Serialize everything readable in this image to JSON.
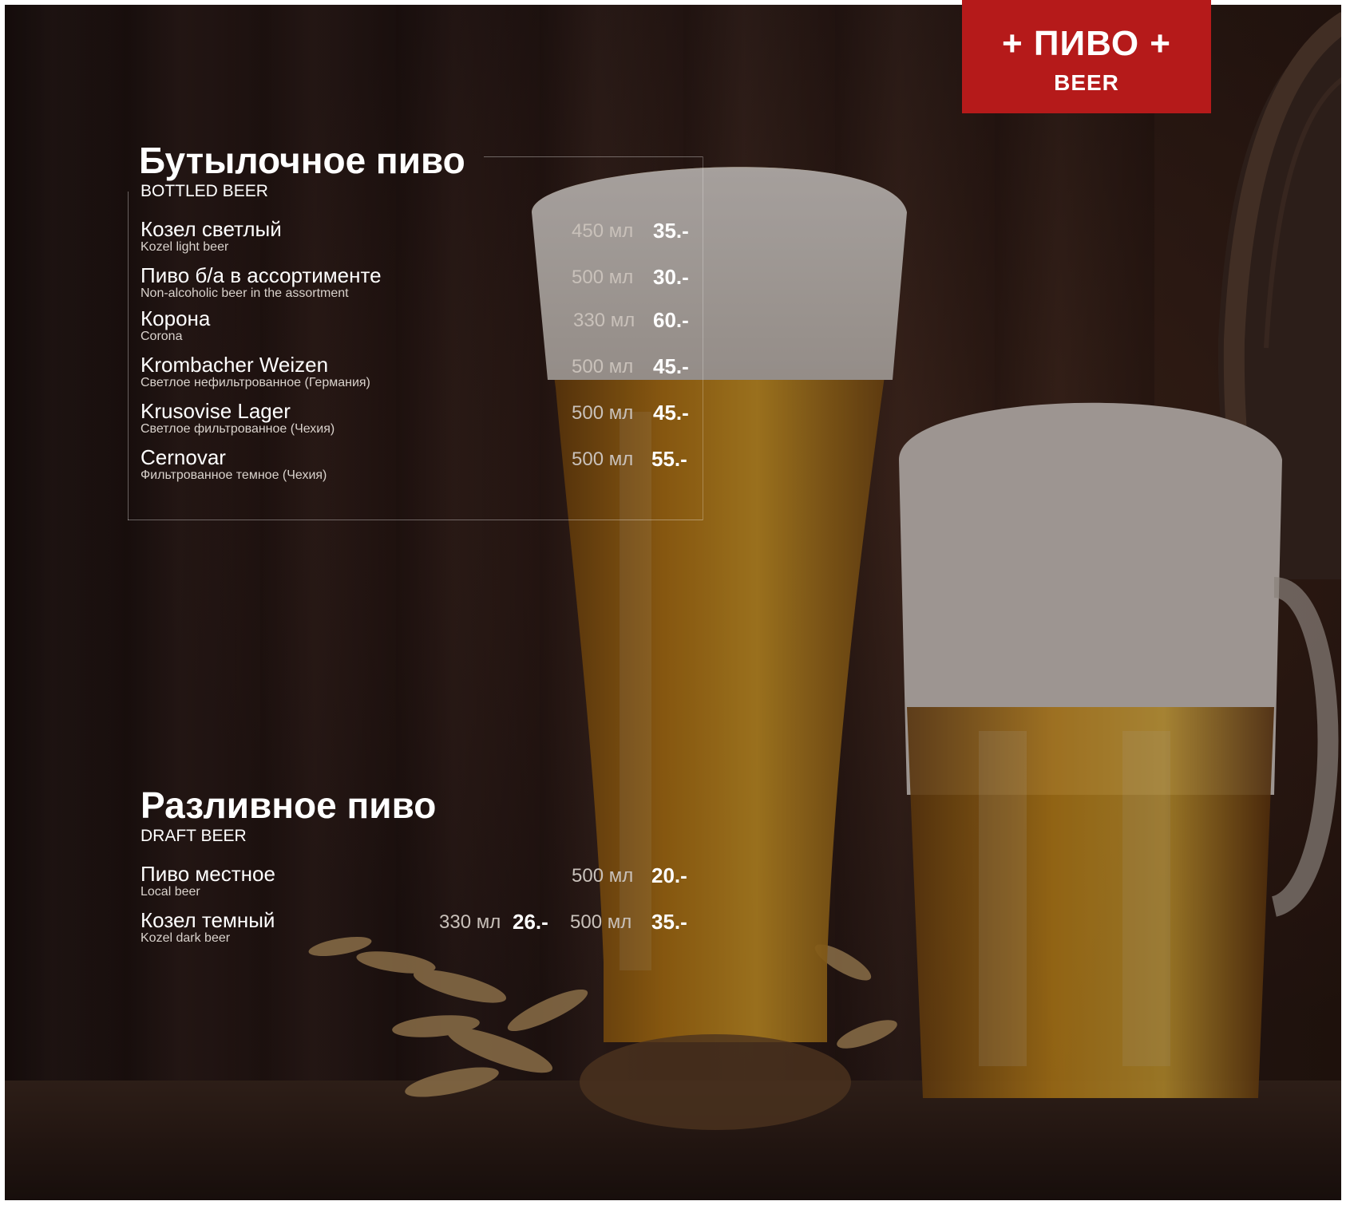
{
  "header": {
    "title": "+ ПИВО +",
    "subtitle": "BEER",
    "accent_color": "#b51a1a"
  },
  "bottled": {
    "title": "Бутылочное пиво",
    "subtitle": "BOTTLED BEER",
    "items": [
      {
        "name": "Козел светлый",
        "desc": "Kozel light beer",
        "volume": "450 мл",
        "price": "35.-"
      },
      {
        "name": "Пиво б/а в ассортименте",
        "desc": "Non-alcoholic beer in the assortment",
        "volume": "500 мл",
        "price": "30.-"
      },
      {
        "name": "Корона",
        "desc": "Corona",
        "volume": "330 мл",
        "price": "60.-"
      },
      {
        "name": "Krombacher Weizen",
        "desc": "Светлое нефильтрованное (Германия)",
        "volume": "500 мл",
        "price": "45.-"
      },
      {
        "name": "Krusovise Lager",
        "desc": "Светлое фильтрованное (Чехия)",
        "volume": "500 мл",
        "price": "45.-"
      },
      {
        "name": "Cernovar",
        "desc": "Фильтрованное темное (Чехия)",
        "volume": "500 мл",
        "price": "55.-"
      }
    ]
  },
  "draft": {
    "title": "Разливное пиво",
    "subtitle": "DRAFT BEER",
    "items": [
      {
        "name": "Пиво местное",
        "desc": "Local beer",
        "volume": "500 мл",
        "price": "20.-"
      },
      {
        "name": "Козел темный",
        "desc": "Kozel dark beer",
        "volume_small": "330 мл",
        "price_small": "26.-",
        "volume": "500 мл",
        "price": "35.-"
      }
    ]
  }
}
